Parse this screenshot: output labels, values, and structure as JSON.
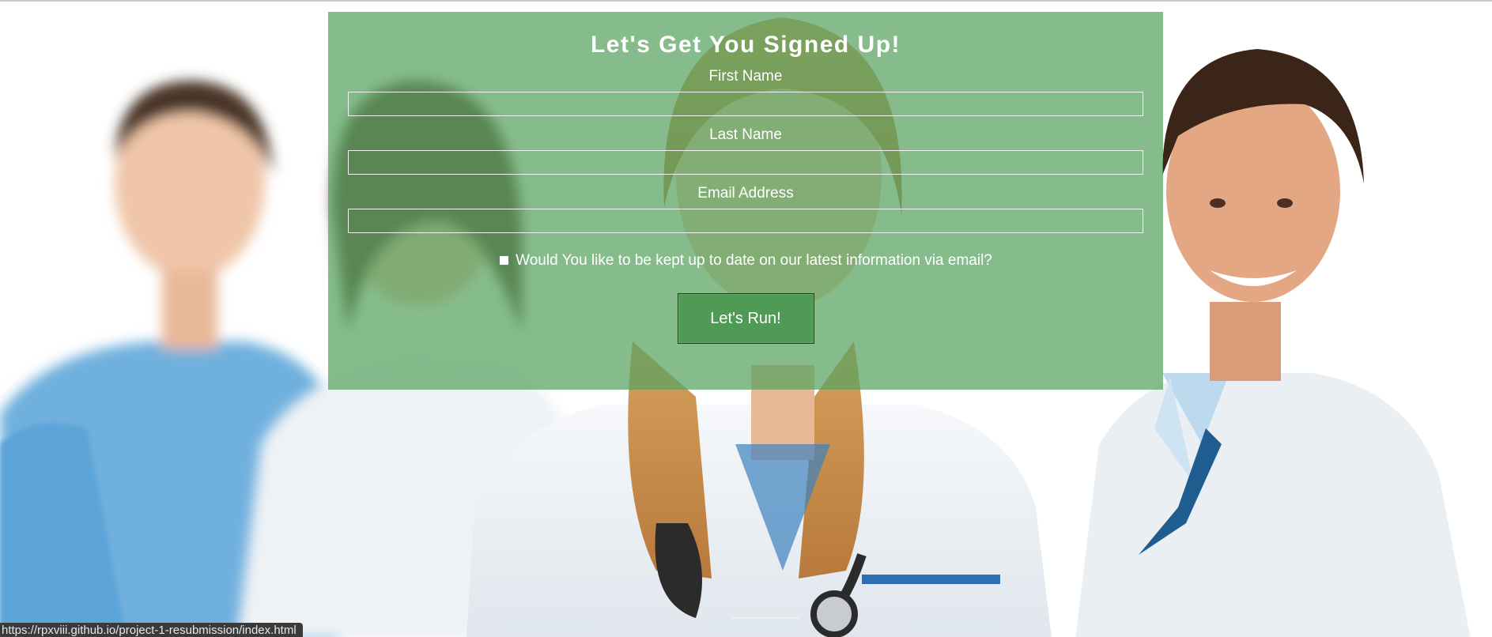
{
  "form": {
    "title": "Let's Get You Signed Up!",
    "fields": [
      {
        "label": "First Name",
        "value": ""
      },
      {
        "label": "Last Name",
        "value": ""
      },
      {
        "label": "Email Address",
        "value": ""
      }
    ],
    "newsletter_label": "Would You like to be kept up to date on our latest information via email?",
    "newsletter_checked": false,
    "submit_label": "Let's Run!"
  },
  "status_bar": {
    "link_url": "https://rpxviii.github.io/project-1-resubmission/index.html"
  },
  "colors": {
    "panel_overlay": "#58a260",
    "button": "#4f9a55"
  }
}
